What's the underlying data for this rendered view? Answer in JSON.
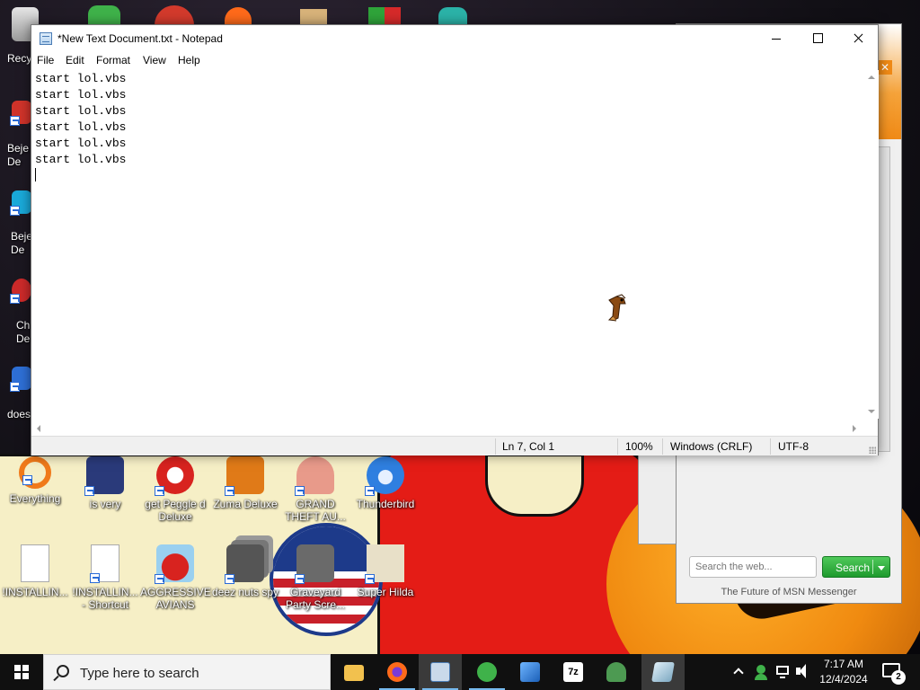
{
  "notepad": {
    "title": "*New Text Document.txt - Notepad",
    "menu": [
      "File",
      "Edit",
      "Format",
      "View",
      "Help"
    ],
    "lines": [
      "start lol.vbs",
      "start lol.vbs",
      "start lol.vbs",
      "start lol.vbs",
      "start lol.vbs",
      "start lol.vbs"
    ],
    "status": {
      "position": "Ln 7, Col 1",
      "zoom": "100%",
      "line_ending": "Windows (CRLF)",
      "encoding": "UTF-8"
    }
  },
  "desktop": {
    "partial_labels": {
      "recycle": "Recy",
      "bejeweled1": "Beje De",
      "bejeweled2": "Beje De",
      "chrome_like": "Ch De",
      "does": "does"
    },
    "icons": [
      {
        "label": "Everything",
        "color": "#f07a1a",
        "icon": "everything-icon"
      },
      {
        "label": "is very",
        "color": "#2a3a7a",
        "icon": "shield-icon"
      },
      {
        "label": "get Peggle d Deluxe",
        "color": "#d8231f",
        "icon": "peggle-icon"
      },
      {
        "label": "Zuma Deluxe",
        "color": "#e07a18",
        "icon": "zuma-icon"
      },
      {
        "label": "GRAND THEFT AU...",
        "color": "#e89a8a",
        "icon": "anime-girl-icon"
      },
      {
        "label": "Thunderbird",
        "color": "#2f7fe0",
        "icon": "thunderbird-icon"
      },
      {
        "label": "!INSTALLIN...",
        "color": "#ffffff",
        "icon": "text-file-icon"
      },
      {
        "label": "!INSTALLIN... - Shortcut",
        "color": "#ffffff",
        "icon": "text-file-icon"
      },
      {
        "label": "AGGRESSIVE AVIANS",
        "color": "#d8231f",
        "icon": "angry-bird-icon"
      },
      {
        "label": "deez nuts spy",
        "color": "#555555",
        "icon": "windows-stack-icon"
      },
      {
        "label": "Graveyard Party Scre...",
        "color": "#6a6a6a",
        "icon": "graveyard-icon"
      },
      {
        "label": "Super Hilda",
        "color": "#e8e0c8",
        "icon": "pixel-cat-icon"
      }
    ]
  },
  "msn": {
    "search_placeholder": "Search the web...",
    "search_button": "Search",
    "footer": "The Future of MSN Messenger"
  },
  "taskbar": {
    "search_placeholder": "Type here to search",
    "apps": [
      {
        "name": "file-explorer-icon",
        "color": "#f2c14e"
      },
      {
        "name": "firefox-icon",
        "color": "#ff6a1a"
      },
      {
        "name": "notepad-icon",
        "color": "#c9d9ea"
      },
      {
        "name": "msn-messenger-icon",
        "color": "#3fb24a"
      },
      {
        "name": "photos-icon",
        "color": "#2e7fd6"
      },
      {
        "name": "7zip-icon",
        "color": "#ffffff"
      },
      {
        "name": "frog-app-icon",
        "color": "#4d9a52"
      },
      {
        "name": "glass-app-icon",
        "color": "#9fc3d8"
      }
    ],
    "clock": {
      "time": "7:17 AM",
      "date": "12/4/2024"
    },
    "notification_count": "2"
  },
  "colors": {
    "accent": "#0078d7",
    "taskbar_bg": "#101010",
    "msn_green": "#1f9a2e",
    "wallpaper_red": "#e41c16"
  }
}
